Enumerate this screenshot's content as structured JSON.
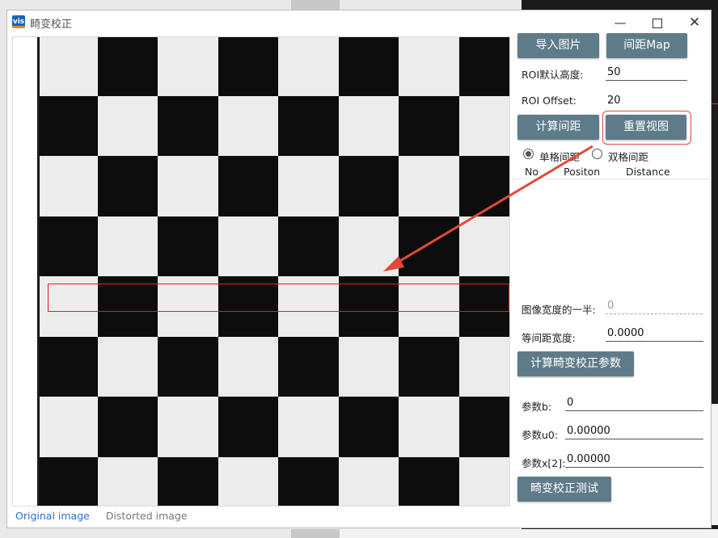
{
  "window": {
    "title": "畸变校正",
    "icon_text": "vis",
    "controls": {
      "minimize": "—",
      "close": "✕"
    }
  },
  "image_tabs": [
    {
      "label": "Original image",
      "active": true
    },
    {
      "label": "Distorted image",
      "active": false
    }
  ],
  "buttons": {
    "import_image": "导入图片",
    "spacing_map": "间距Map",
    "compute_spacing": "计算间距",
    "reset_view": "重置视图",
    "compute_params": "计算畸变校正参数",
    "correction_test": "畸变校正测试"
  },
  "roi": {
    "height_label": "ROI默认高度:",
    "height_value": "50",
    "offset_label": "ROI Offset:",
    "offset_value": "20"
  },
  "radio": {
    "single_label": "单格间距",
    "double_label": "双格间距",
    "selected": "single"
  },
  "table": {
    "columns": [
      "No",
      "Positon",
      "Distance"
    ]
  },
  "fields": {
    "half_width_label": "图像宽度的一半:",
    "half_width_value": "0",
    "equal_spacing_label": "等间距宽度:",
    "equal_spacing_value": "0.0000",
    "param_b_label": "参数b:",
    "param_b_value": "0",
    "param_u0_label": "参数u0:",
    "param_u0_value": "0.00000",
    "param_x2_label": "参数x[2]:",
    "param_x2_value": "0.00000"
  },
  "colors": {
    "button_bg": "#5e7b89",
    "highlight": "#e04a3a",
    "roi_rect": "#e02020",
    "active_tab": "#2b6fd6"
  }
}
